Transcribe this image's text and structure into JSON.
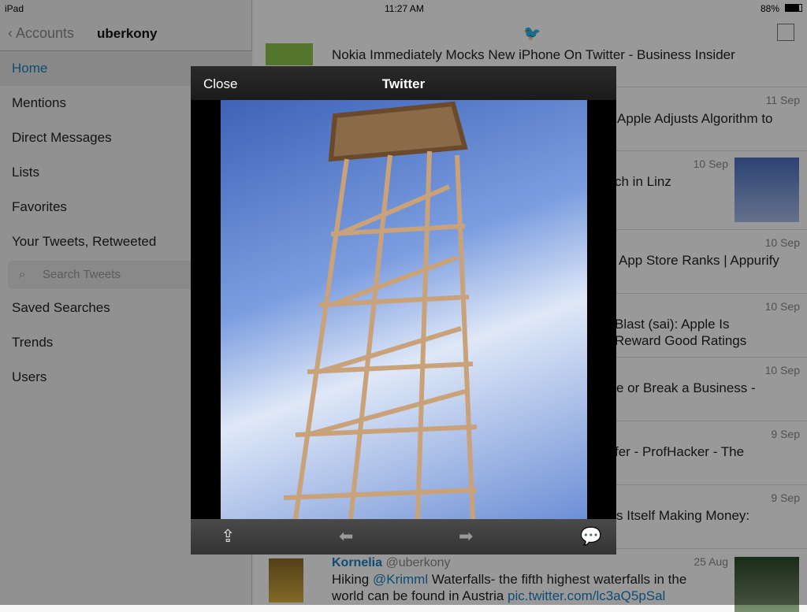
{
  "status": {
    "device": "iPad",
    "time": "11:27 AM",
    "battery": "88%"
  },
  "sidebar": {
    "back_label": "Accounts",
    "account": "uberkony",
    "items": [
      {
        "label": "Home"
      },
      {
        "label": "Mentions"
      },
      {
        "label": "Direct Messages"
      },
      {
        "label": "Lists"
      },
      {
        "label": "Favorites"
      },
      {
        "label": "Your Tweets, Retweeted"
      }
    ],
    "search_placeholder": "Search Tweets",
    "items2": [
      {
        "label": "Saved Searches"
      },
      {
        "label": "Trends"
      },
      {
        "label": "Users"
      }
    ]
  },
  "timeline": [
    {
      "text": "Nokia Immediately Mocks New iPhone On Twitter - Business Insider",
      "date": ""
    },
    {
      "text": "Apple Adjusts Algorithm to",
      "date": "11 Sep"
    },
    {
      "text": "ch in Linz",
      "date": "10 Sep"
    },
    {
      "text": "App Store Ranks | Appurify",
      "date": "10 Sep"
    },
    {
      "text": "Blast (sai): Apple Is\nReward Good Ratings",
      "date": "10 Sep"
    },
    {
      "text": "e or Break a Business -",
      "date": "10 Sep"
    },
    {
      "text": "fer - ProfHacker - The",
      "date": "9 Sep"
    },
    {
      "text": "s Itself Making Money:",
      "date": "9 Sep"
    }
  ],
  "last_tweet": {
    "name": "Kornelia",
    "handle": "@uberkony",
    "date": "25 Aug",
    "text1": "Hiking ",
    "mention": "@Krimml",
    "text2": " Waterfalls- the fifth highest waterfalls in the world can be found in Austria ",
    "link": "pic.twitter.com/lc3aQ5pSal"
  },
  "modal": {
    "close_label": "Close",
    "title": "Twitter"
  }
}
